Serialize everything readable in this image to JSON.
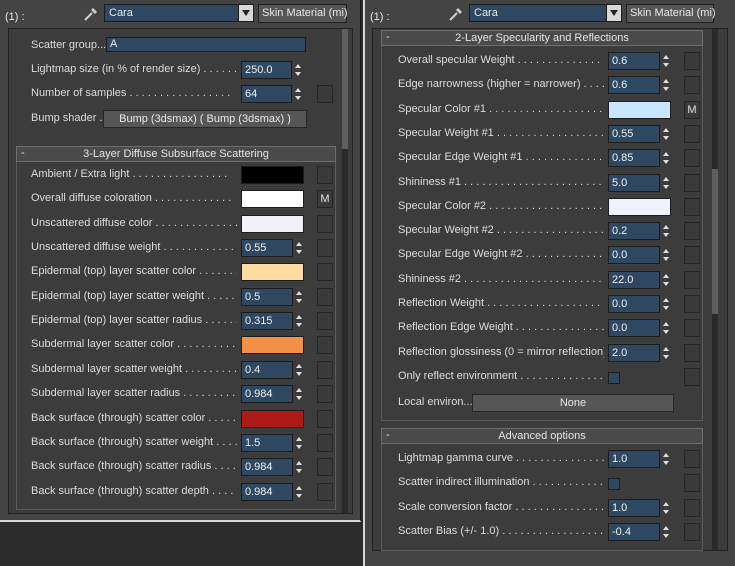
{
  "panels": {
    "left": {
      "header": {
        "label": "(1) :",
        "material": "Cara",
        "type_button": "Skin Material (mi)"
      },
      "general": {
        "scatter_group_label": "Scatter group...",
        "scatter_group_value": "A",
        "lightmap_label": "Lightmap size (in % of render size) . . . . . . . . .",
        "lightmap_value": "250.0",
        "samples_label": "Number of samples . . . . . . . . . . . . . . . . .",
        "samples_value": "64",
        "bump_label": "Bump shader . . .",
        "bump_value": "Bump (3dsmax)  ( Bump (3dsmax) )"
      },
      "diffuse_rollout": {
        "title": "3-Layer Diffuse Subsurface Scattering",
        "rows": [
          {
            "label": "Ambient / Extra light . . . . . . . . . . . . . . . .",
            "kind": "color",
            "color": "#000000",
            "map": ""
          },
          {
            "label": "Overall diffuse coloration . . . . . . . . . . . . .",
            "kind": "color",
            "color": "#ffffff",
            "map": "M"
          },
          {
            "label": "Unscattered diffuse color . . . . . . . . . . . . . .",
            "kind": "color",
            "color": "#f4f0fa",
            "map": ""
          },
          {
            "label": "Unscattered diffuse weight . . . . . . . . . . . . .",
            "kind": "spin",
            "value": "0.55"
          },
          {
            "label": "Epidermal (top) layer scatter color . . . . . . . .",
            "kind": "color",
            "color": "#ffdca0",
            "map": ""
          },
          {
            "label": "Epidermal (top) layer scatter weight . . . . . . .",
            "kind": "spin",
            "value": "0.5"
          },
          {
            "label": "Epidermal (top) layer scatter radius . . . . . . .",
            "kind": "spin",
            "value": "0.315"
          },
          {
            "label": "Subdermal layer scatter color . . . . . . . . . . . .",
            "kind": "color",
            "color": "#f39048",
            "map": ""
          },
          {
            "label": "Subdermal layer scatter weight . . . . . . . . . . .",
            "kind": "spin",
            "value": "0.4"
          },
          {
            "label": "Subdermal layer scatter radius . . . . . . . . . . .",
            "kind": "spin",
            "value": "0.984"
          },
          {
            "label": "Back surface (through) scatter color . . . . . . . .",
            "kind": "color",
            "color": "#ad1a18",
            "map": ""
          },
          {
            "label": "Back surface (through) scatter weight . . . . .",
            "kind": "spin",
            "value": "1.5"
          },
          {
            "label": "Back surface (through) scatter radius . . . . . .",
            "kind": "spin",
            "value": "0.984"
          },
          {
            "label": "Back surface (through) scatter depth . . . . . .",
            "kind": "spin",
            "value": "0.984"
          }
        ]
      }
    },
    "right": {
      "header": {
        "label": "(1) :",
        "material": "Cara",
        "type_button": "Skin Material (mi)"
      },
      "spec_rollout": {
        "title": "2-Layer Specularity and Reflections",
        "rows": [
          {
            "label": "Overall specular Weight . . . . . . . . . . . . . . . . .",
            "kind": "spin",
            "value": "0.6"
          },
          {
            "label": "Edge narrowness (higher = narrower) . . . . .",
            "kind": "spin",
            "value": "0.6"
          },
          {
            "label": "Specular Color #1 . . . . . . . . . . . . . . . . . . . .",
            "kind": "color",
            "color": "#c8e6ff",
            "map": "M"
          },
          {
            "label": "Specular Weight #1 . . . . . . . . . . . . . . . . . . .",
            "kind": "spin",
            "value": "0.55"
          },
          {
            "label": "Specular Edge Weight #1 . . . . . . . . . . . . . . .",
            "kind": "spin",
            "value": "0.85"
          },
          {
            "label": "Shininess #1 . . . . . . . . . . . . . . . . . . . . . . . .",
            "kind": "spin",
            "value": "5.0"
          },
          {
            "label": "Specular Color #2 . . . . . . . . . . . . . . . . . . . .",
            "kind": "color",
            "color": "#eef4ff",
            "map": ""
          },
          {
            "label": "Specular Weight #2 . . . . . . . . . . . . . . . . . . .",
            "kind": "spin",
            "value": "0.2"
          },
          {
            "label": "Specular Edge Weight #2 . . . . . . . . . . . . . . .",
            "kind": "spin",
            "value": "0.0"
          },
          {
            "label": "Shininess #2 . . . . . . . . . . . . . . . . . . . . . . . .",
            "kind": "spin",
            "value": "22.0"
          },
          {
            "label": "Reflection Weight . . . . . . . . . . . . . . . . . . . .",
            "kind": "spin",
            "value": "0.0"
          },
          {
            "label": "Reflection Edge Weight . . . . . . . . . . . . . . . .",
            "kind": "spin",
            "value": "0.0"
          },
          {
            "label": "Reflection glossiness (0 = mirror reflection) . . .",
            "kind": "spin",
            "value": "2.0"
          },
          {
            "label": "Only reflect environment . . . . . . . . . . . . . . .",
            "kind": "check"
          }
        ],
        "local_env_label": "Local environ...",
        "local_env_value": "None"
      },
      "advanced_rollout": {
        "title": "Advanced options",
        "rows": [
          {
            "label": "Lightmap gamma curve . . . . . . . . . . . . . . . .",
            "kind": "spin",
            "value": "1.0"
          },
          {
            "label": "Scatter indirect illumination . . . . . . . . . . . .",
            "kind": "check"
          },
          {
            "label": "Scale conversion factor . . . . . . . . . . . . . . . .",
            "kind": "spin",
            "value": "1.0"
          },
          {
            "label": "Scatter Bias (+/- 1.0) . . . . . . . . . . . . . . . . .",
            "kind": "spin",
            "value": "-0.4"
          }
        ]
      },
      "rollout_toggle": "-"
    }
  },
  "colors": {
    "spinner_bg": "#2e4862",
    "panel_bg": "#444444",
    "content_bg": "#3c3c3c"
  }
}
